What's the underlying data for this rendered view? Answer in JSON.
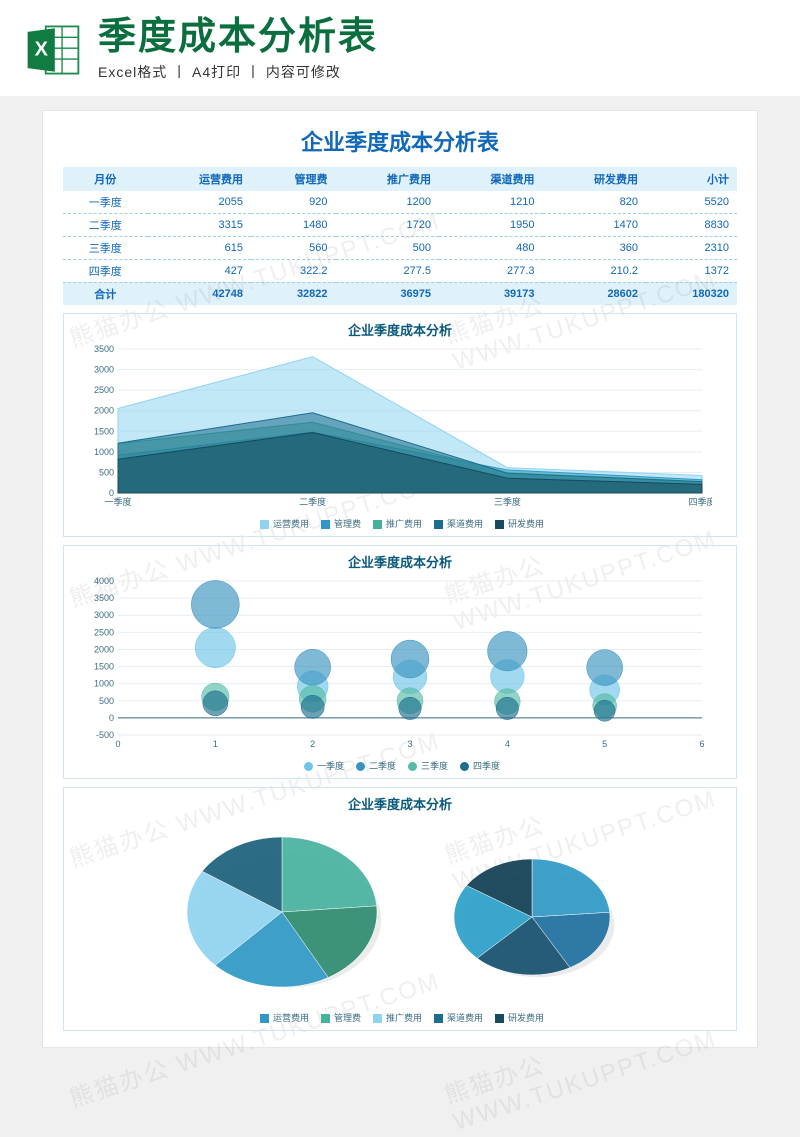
{
  "header": {
    "title": "季度成本分析表",
    "subtitle": "Excel格式 丨 A4打印 丨 内容可修改"
  },
  "document": {
    "title": "企业季度成本分析表"
  },
  "watermark": "熊猫办公 WWW.TUKUPPT.COM",
  "table": {
    "headers": [
      "月份",
      "运营费用",
      "管理费",
      "推广费用",
      "渠道费用",
      "研发费用",
      "小计"
    ],
    "rows": [
      [
        "一季度",
        "2055",
        "920",
        "1200",
        "1210",
        "820",
        "5520"
      ],
      [
        "二季度",
        "3315",
        "1480",
        "1720",
        "1950",
        "1470",
        "8830"
      ],
      [
        "三季度",
        "615",
        "560",
        "500",
        "480",
        "360",
        "2310"
      ],
      [
        "四季度",
        "427",
        "322.2",
        "277.5",
        "277.3",
        "210.2",
        "1372"
      ]
    ],
    "total": [
      "合计",
      "42748",
      "32822",
      "36975",
      "39173",
      "28602",
      "180320"
    ]
  },
  "charts": {
    "area": {
      "title": "企业季度成本分析"
    },
    "bubble": {
      "title": "企业季度成本分析"
    },
    "pie": {
      "title": "企业季度成本分析"
    }
  },
  "legend_categories": [
    "运营费用",
    "管理费",
    "推广费用",
    "渠道费用",
    "研发费用"
  ],
  "legend_quarters": [
    "一季度",
    "二季度",
    "三季度",
    "四季度"
  ],
  "colors": {
    "c1": "#8fd3f0",
    "c2": "#2f98c4",
    "c3": "#46b19d",
    "c4": "#1c6e8f",
    "c5": "#164a5d",
    "q1": "#6ec4e9",
    "q2": "#3a93bf",
    "q3": "#56bca5",
    "q4": "#1d6f8f"
  },
  "chart_data": [
    {
      "type": "area",
      "title": "企业季度成本分析",
      "categories": [
        "一季度",
        "二季度",
        "三季度",
        "四季度"
      ],
      "series": [
        {
          "name": "运营费用",
          "values": [
            2055,
            3315,
            615,
            427
          ]
        },
        {
          "name": "管理费",
          "values": [
            920,
            1480,
            560,
            322.2
          ]
        },
        {
          "name": "推广费用",
          "values": [
            1200,
            1720,
            500,
            277.5
          ]
        },
        {
          "name": "渠道费用",
          "values": [
            1210,
            1950,
            480,
            277.3
          ]
        },
        {
          "name": "研发费用",
          "values": [
            820,
            1470,
            360,
            210.2
          ]
        }
      ],
      "ylim": [
        0,
        3500
      ],
      "yticks": [
        0,
        500,
        1000,
        1500,
        2000,
        2500,
        3000,
        3500
      ]
    },
    {
      "type": "scatter",
      "title": "企业季度成本分析",
      "x": [
        1,
        2,
        3,
        4,
        5
      ],
      "xlabels_note": "x positions correspond to the 5 cost categories",
      "series": [
        {
          "name": "一季度",
          "values": [
            2055,
            920,
            1200,
            1210,
            820
          ]
        },
        {
          "name": "二季度",
          "values": [
            3315,
            1480,
            1720,
            1950,
            1470
          ]
        },
        {
          "name": "三季度",
          "values": [
            615,
            560,
            500,
            480,
            360
          ]
        },
        {
          "name": "四季度",
          "values": [
            427,
            322.2,
            277.5,
            277.3,
            210.2
          ]
        }
      ],
      "xlim": [
        0,
        6
      ],
      "ylim": [
        -500,
        4000
      ],
      "yticks": [
        -500,
        0,
        500,
        1000,
        1500,
        2000,
        2500,
        3000,
        3500,
        4000
      ]
    },
    {
      "type": "pie",
      "title": "企业季度成本分析",
      "pies": [
        {
          "categories": [
            "运营费用",
            "管理费",
            "推广费用",
            "渠道费用",
            "研发费用"
          ],
          "values": [
            42748,
            32822,
            36975,
            39173,
            28602
          ]
        },
        {
          "categories": [
            "运营费用",
            "管理费",
            "推广费用",
            "渠道费用",
            "研发费用"
          ],
          "values": [
            42748,
            32822,
            36975,
            39173,
            28602
          ]
        }
      ]
    }
  ]
}
